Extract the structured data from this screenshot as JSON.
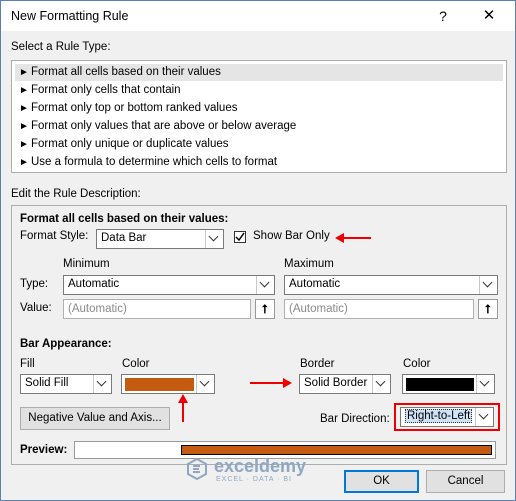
{
  "window": {
    "title": "New Formatting Rule",
    "help_glyph": "?",
    "close_glyph": "✕"
  },
  "rule_type": {
    "section_label": "Select a Rule Type:",
    "items": [
      "Format all cells based on their values",
      "Format only cells that contain",
      "Format only top or bottom ranked values",
      "Format only values that are above or below average",
      "Format only unique or duplicate values",
      "Use a formula to determine which cells to format"
    ],
    "selected_index": 0
  },
  "description": {
    "section_label": "Edit the Rule Description:",
    "heading": "Format all cells based on their values:",
    "format_style_label": "Format Style:",
    "format_style_value": "Data Bar",
    "show_bar_only_label": "Show Bar Only",
    "show_bar_only_checked": true,
    "minimum": {
      "header": "Minimum",
      "type_value": "Automatic",
      "value_placeholder": "(Automatic)"
    },
    "maximum": {
      "header": "Maximum",
      "type_value": "Automatic",
      "value_placeholder": "(Automatic)"
    },
    "type_label": "Type:",
    "value_label": "Value:",
    "bar_appearance": {
      "heading": "Bar Appearance:",
      "fill_label": "Fill",
      "fill_value": "Solid Fill",
      "color_label": "Color",
      "fill_color": "#c55a11",
      "border_label": "Border",
      "border_value": "Solid Border",
      "border_color_label": "Color",
      "border_color": "#000000",
      "negative_button": "Negative Value and Axis...",
      "bar_direction_label": "Bar Direction:",
      "bar_direction_value": "Right-to-Left"
    },
    "preview_label": "Preview:",
    "preview_bar_color": "#c55a11"
  },
  "buttons": {
    "ok": "OK",
    "cancel": "Cancel"
  },
  "watermark": {
    "name": "exceldemy",
    "tagline": "EXCEL · DATA · BI"
  },
  "annotation_color": "#e00000"
}
